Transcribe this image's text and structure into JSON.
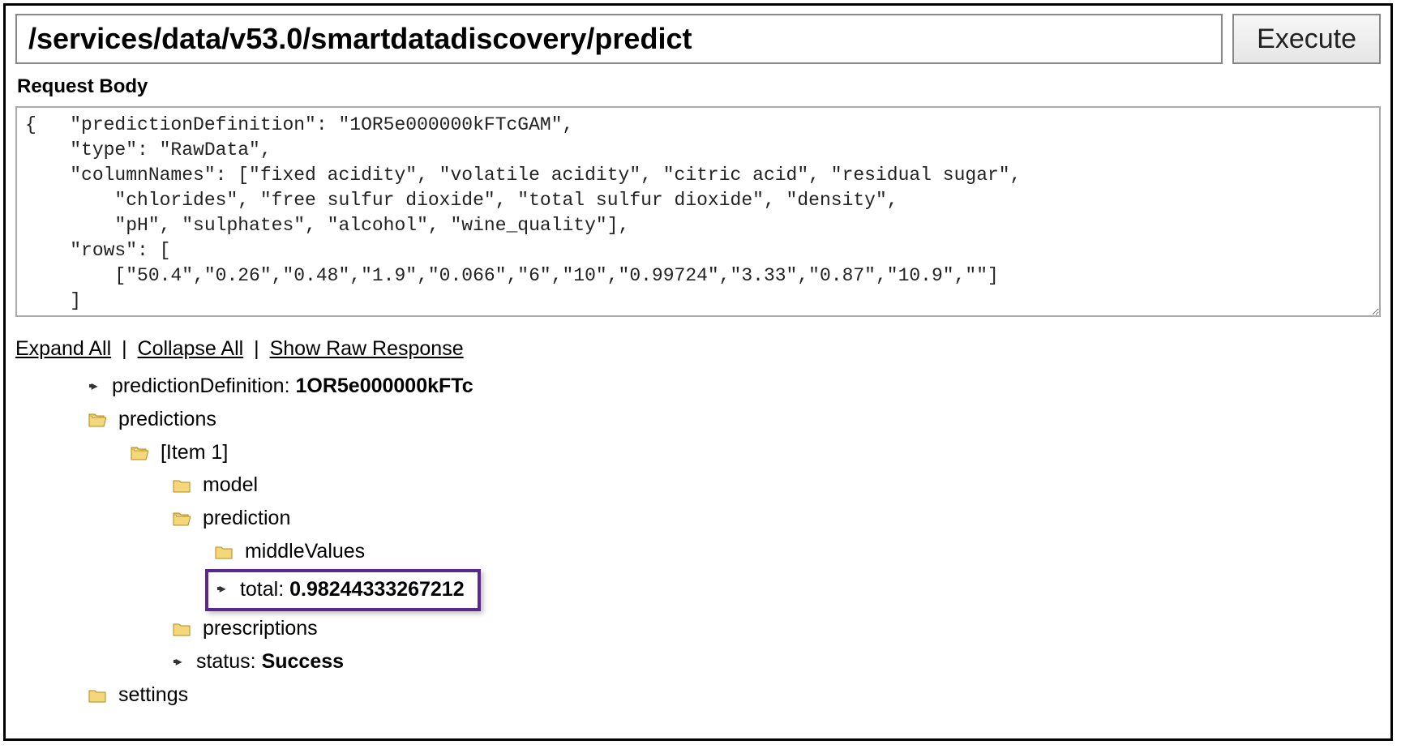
{
  "url": "/services/data/v53.0/smartdatadiscovery/predict",
  "execute_label": "Execute",
  "section_label": "Request Body",
  "request_body": "{   \"predictionDefinition\": \"1OR5e000000kFTcGAM\",\n    \"type\": \"RawData\",\n    \"columnNames\": [\"fixed acidity\", \"volatile acidity\", \"citric acid\", \"residual sugar\",\n        \"chlorides\", \"free sulfur dioxide\", \"total sulfur dioxide\", \"density\",\n        \"pH\", \"sulphates\", \"alcohol\", \"wine_quality\"],\n    \"rows\": [\n        [\"50.4\",\"0.26\",\"0.48\",\"1.9\",\"0.066\",\"6\",\"10\",\"0.99724\",\"3.33\",\"0.87\",\"10.9\",\"\"]\n    ]\n}",
  "controls": {
    "expand": "Expand All",
    "collapse": "Collapse All",
    "raw": "Show Raw Response"
  },
  "tree": {
    "predictionDefinition_key": "predictionDefinition:",
    "predictionDefinition_val": "1OR5e000000kFTc",
    "predictions_label": "predictions",
    "item1_label": "[Item 1]",
    "model_label": "model",
    "prediction_label": "prediction",
    "middleValues_label": "middleValues",
    "total_key": "total:",
    "total_val": "0.98244333267212",
    "prescriptions_label": "prescriptions",
    "status_key": "status:",
    "status_val": "Success",
    "settings_label": "settings"
  }
}
